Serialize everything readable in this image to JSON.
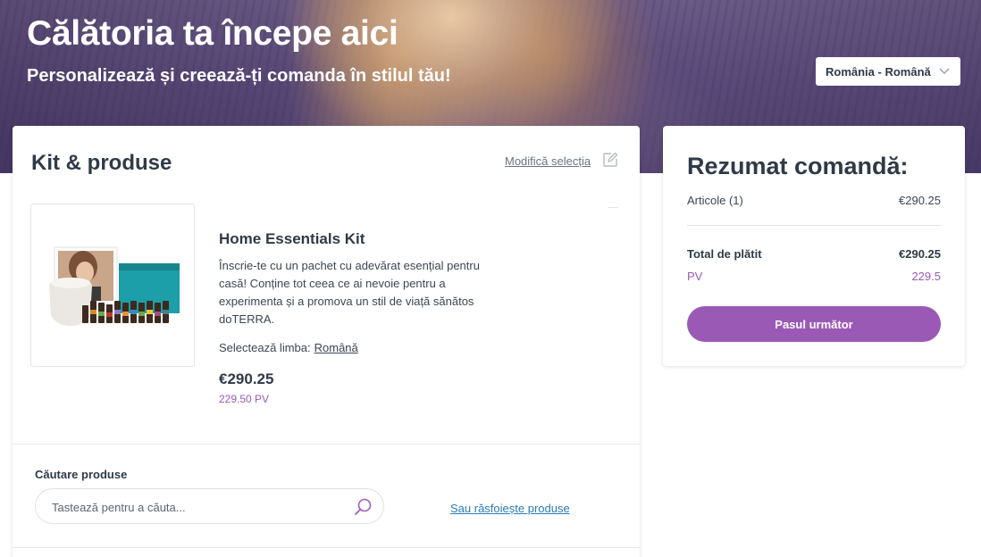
{
  "hero": {
    "title": "Călătoria ta începe aici",
    "subtitle": "Personalizează și creează-ți comanda în stilul tău!",
    "locale_label": "România - Română"
  },
  "kit_panel": {
    "title": "Kit & produse",
    "modify_label": "Modifică selecția",
    "product": {
      "name": "Home Essentials Kit",
      "description": "Înscrie-te cu un pachet cu adevărat esențial pentru casă! Conține tot ceea ce ai nevoie pentru a experimenta și a promova un stil de viață sănătos doTERRA.",
      "language_label": "Selectează limba:",
      "language_value": "Română",
      "price": "€290.25",
      "pv": "229.50 PV"
    },
    "search": {
      "label": "Căutare produse",
      "placeholder": "Tastează pentru a căuta...",
      "browse_link": "Sau răsfoiește produse"
    }
  },
  "summary": {
    "title": "Rezumat comandă:",
    "items_label": "Articole (1)",
    "items_value": "€290.25",
    "total_label": "Total de plătit",
    "total_value": "€290.25",
    "pv_label": "PV",
    "pv_value": "229.5",
    "next_button": "Pasul următor"
  },
  "colors": {
    "accent": "#9b59b6",
    "text": "#2f3a48",
    "link": "#2a7ab8"
  },
  "icons": [
    "chevron-down-icon",
    "edit-icon",
    "search-icon"
  ]
}
